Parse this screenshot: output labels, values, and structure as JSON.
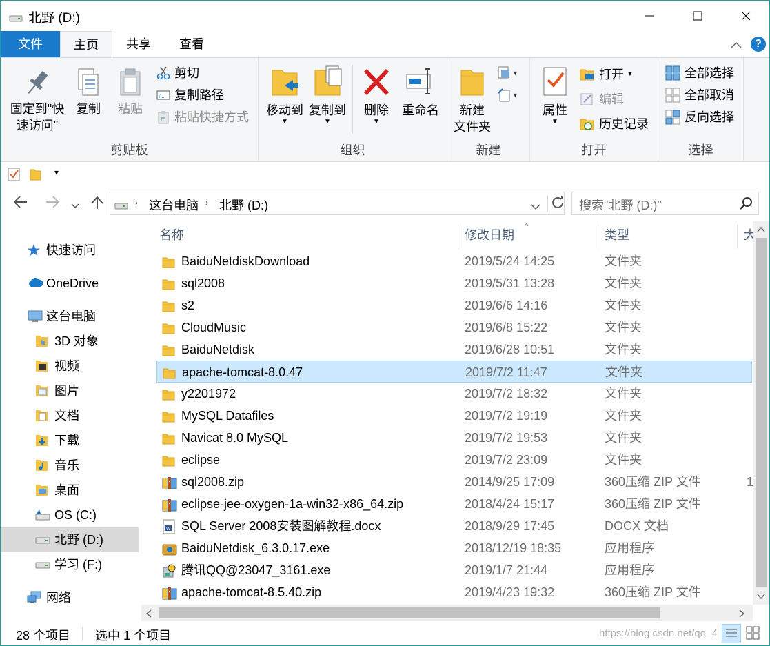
{
  "window": {
    "title": "北野 (D:)",
    "controls": [
      "minimize",
      "maximize",
      "close"
    ]
  },
  "ribbon_tabs": [
    {
      "label": "文件",
      "active": false
    },
    {
      "label": "主页",
      "active": true
    },
    {
      "label": "共享",
      "active": false
    },
    {
      "label": "查看",
      "active": false
    }
  ],
  "ribbon": {
    "clipboard": {
      "label": "剪贴板",
      "pin": "固定到\"快",
      "pin2": "速访问\"",
      "copy": "复制",
      "paste": "粘贴",
      "cut": "剪切",
      "copy_path": "复制路径",
      "paste_shortcut": "粘贴快捷方式"
    },
    "organize": {
      "label": "组织",
      "move_to": "移动到",
      "copy_to": "复制到",
      "delete": "删除",
      "rename": "重命名"
    },
    "new": {
      "label": "新建",
      "new_folder": "新建",
      "new_folder2": "文件夹"
    },
    "open": {
      "label": "打开",
      "properties": "属性",
      "open": "打开",
      "edit": "编辑",
      "history": "历史记录"
    },
    "select": {
      "label": "选择",
      "select_all": "全部选择",
      "select_none": "全部取消",
      "invert": "反向选择"
    }
  },
  "address": {
    "crumbs": [
      "这台电脑",
      "北野 (D:)"
    ],
    "search_placeholder": "搜索\"北野 (D:)\""
  },
  "nav_pane": [
    {
      "label": "快速访问",
      "icon": "star-icon",
      "indent": 0
    },
    {
      "label": "OneDrive",
      "icon": "cloud-icon",
      "indent": 0
    },
    {
      "label": "这台电脑",
      "icon": "pc-icon",
      "indent": 0
    },
    {
      "label": "3D 对象",
      "icon": "3d-objects-icon",
      "indent": 1
    },
    {
      "label": "视频",
      "icon": "video-folder-icon",
      "indent": 1
    },
    {
      "label": "图片",
      "icon": "pictures-folder-icon",
      "indent": 1
    },
    {
      "label": "文档",
      "icon": "documents-folder-icon",
      "indent": 1
    },
    {
      "label": "下载",
      "icon": "downloads-folder-icon",
      "indent": 1
    },
    {
      "label": "音乐",
      "icon": "music-folder-icon",
      "indent": 1
    },
    {
      "label": "桌面",
      "icon": "desktop-folder-icon",
      "indent": 1
    },
    {
      "label": "OS (C:)",
      "icon": "drive-icon",
      "indent": 1
    },
    {
      "label": "北野 (D:)",
      "icon": "drive-icon",
      "indent": 1,
      "selected": true
    },
    {
      "label": "学习 (F:)",
      "icon": "drive-icon",
      "indent": 1
    },
    {
      "label": "网络",
      "icon": "network-icon",
      "indent": 0
    }
  ],
  "columns": {
    "name": "名称",
    "date": "修改日期",
    "type": "类型",
    "size": "大"
  },
  "files": [
    {
      "name": "BaiduNetdiskDownload",
      "date": "2019/5/24 14:25",
      "type": "文件夹",
      "icon": "folder-icon"
    },
    {
      "name": "sql2008",
      "date": "2019/5/31 13:28",
      "type": "文件夹",
      "icon": "folder-icon"
    },
    {
      "name": "s2",
      "date": "2019/6/6 14:16",
      "type": "文件夹",
      "icon": "folder-icon"
    },
    {
      "name": "CloudMusic",
      "date": "2019/6/8 15:22",
      "type": "文件夹",
      "icon": "folder-icon"
    },
    {
      "name": "BaiduNetdisk",
      "date": "2019/6/28 10:51",
      "type": "文件夹",
      "icon": "folder-icon"
    },
    {
      "name": "apache-tomcat-8.0.47",
      "date": "2019/7/2 11:47",
      "type": "文件夹",
      "icon": "folder-icon",
      "selected": true
    },
    {
      "name": "y2201972",
      "date": "2019/7/2 18:32",
      "type": "文件夹",
      "icon": "folder-icon"
    },
    {
      "name": "MySQL Datafiles",
      "date": "2019/7/2 19:19",
      "type": "文件夹",
      "icon": "folder-icon"
    },
    {
      "name": "Navicat 8.0 MySQL",
      "date": "2019/7/2 19:53",
      "type": "文件夹",
      "icon": "folder-icon"
    },
    {
      "name": "eclipse",
      "date": "2019/7/2 23:09",
      "type": "文件夹",
      "icon": "folder-icon"
    },
    {
      "name": "sql2008.zip",
      "date": "2014/9/25 17:09",
      "type": "360压缩 ZIP 文件",
      "size": "1",
      "icon": "zip-icon"
    },
    {
      "name": "eclipse-jee-oxygen-1a-win32-x86_64.zip",
      "date": "2018/4/24 15:17",
      "type": "360压缩 ZIP 文件",
      "icon": "zip-icon"
    },
    {
      "name": "SQL Server 2008安装图解教程.docx",
      "date": "2018/9/29 17:45",
      "type": "DOCX 文档",
      "icon": "docx-icon"
    },
    {
      "name": "BaiduNetdisk_6.3.0.17.exe",
      "date": "2018/12/19 18:35",
      "type": "应用程序",
      "icon": "exe-icon"
    },
    {
      "name": "腾讯QQ@23047_3161.exe",
      "date": "2019/1/7 21:44",
      "type": "应用程序",
      "icon": "installer-icon"
    },
    {
      "name": "apache-tomcat-8.5.40.zip",
      "date": "2019/4/23 19:32",
      "type": "360压缩 ZIP 文件",
      "icon": "zip-icon"
    }
  ],
  "status": {
    "item_count": "28 个项目",
    "selected": "选中 1 个项目",
    "watermark": "https://blog.csdn.net/qq_4"
  },
  "colors": {
    "accent": "#1979ca",
    "selection": "#cce8ff",
    "folder": "#f5c342"
  }
}
